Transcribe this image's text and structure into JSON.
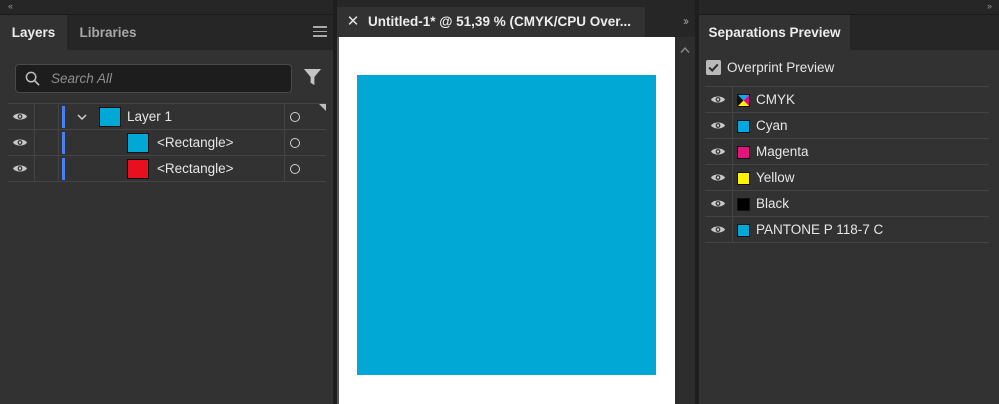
{
  "layers_panel": {
    "tabs": [
      {
        "label": "Layers",
        "active": true
      },
      {
        "label": "Libraries",
        "active": false
      }
    ],
    "collapse_glyph": "‹‹",
    "search": {
      "placeholder": "Search All",
      "value": ""
    },
    "layers": [
      {
        "label": "Layer 1",
        "thumb_color": "#01a8d6",
        "expanded": true,
        "level": 0
      },
      {
        "label": "<Rectangle>",
        "thumb_color": "#01a8d6",
        "level": 1
      },
      {
        "label": "<Rectangle>",
        "thumb_color": "#e8101f",
        "level": 1
      }
    ],
    "layer_color": "#4f7cf0"
  },
  "document": {
    "close_glyph": "✕",
    "title": "Untitled-1* @ 51,39 % (CMYK/CPU Over...",
    "overflow_glyph": "››",
    "shape_color": "#01a8d6"
  },
  "separations_panel": {
    "collapse_glyph": "››",
    "tab_label": "Separations Preview",
    "overprint_label": "Overprint Preview",
    "overprint_checked": true,
    "separations": [
      {
        "label": "CMYK",
        "swatch": "cmyk"
      },
      {
        "label": "Cyan",
        "swatch": "#01a8e0"
      },
      {
        "label": "Magenta",
        "swatch": "#e5137c"
      },
      {
        "label": "Yellow",
        "swatch": "#fff200"
      },
      {
        "label": "Black",
        "swatch": "#000000"
      },
      {
        "label": "PANTONE P 118-7 C",
        "swatch": "#01a8d6"
      }
    ]
  }
}
